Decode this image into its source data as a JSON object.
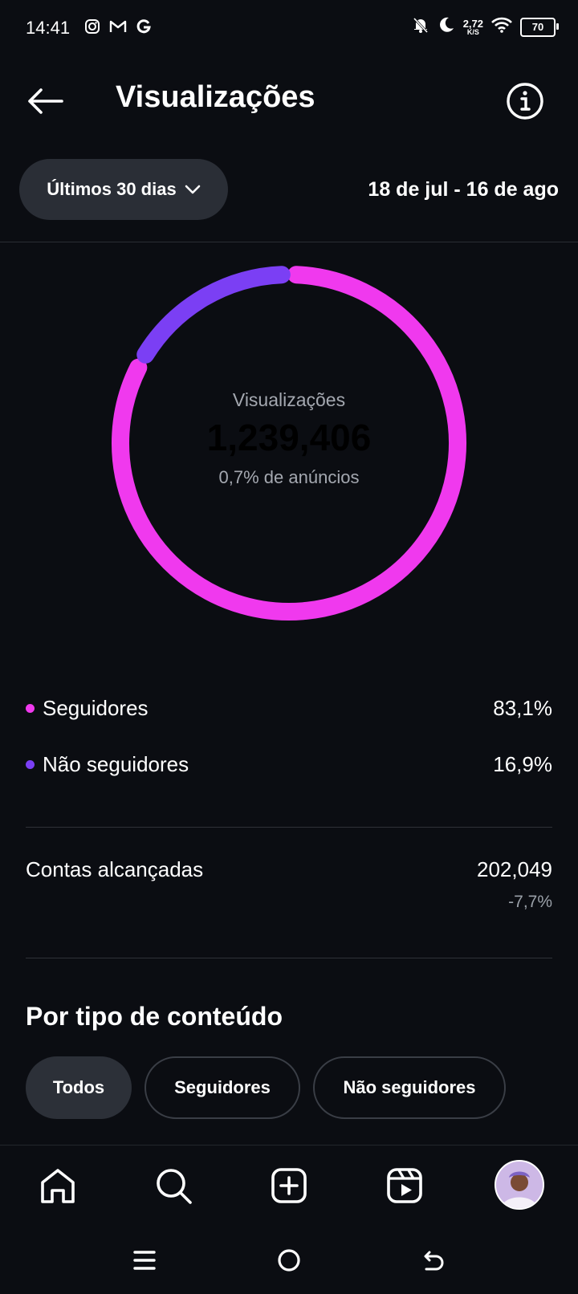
{
  "status_bar": {
    "time": "14:41",
    "net_speed": "2,72",
    "net_unit": "K/S",
    "battery": "70",
    "left_icons": [
      "instagram-icon",
      "gmail-icon",
      "google-icon"
    ],
    "right_icons": [
      "bell-muted-icon",
      "moon-icon",
      "wifi-icon",
      "battery-icon"
    ]
  },
  "header": {
    "title": "Visualizações",
    "back_icon": "arrow-left-icon",
    "info_icon": "info-icon"
  },
  "filters": {
    "range_label": "Últimos 30 dias",
    "date_range": "18 de jul - 16 de ago"
  },
  "chart_data": {
    "type": "pie",
    "style": "donut",
    "center_label": "Visualizações",
    "center_value": "1,239,406",
    "center_sub": "0,7% de anúncios",
    "series": [
      {
        "name": "Seguidores",
        "value": 83.1,
        "color": "#f039ee"
      },
      {
        "name": "Não seguidores",
        "value": 16.9,
        "color": "#7b3ff4"
      }
    ]
  },
  "legend": [
    {
      "label": "Seguidores",
      "value": "83,1%",
      "color": "#f039ee"
    },
    {
      "label": "Não seguidores",
      "value": "16,9%",
      "color": "#7b3ff4"
    }
  ],
  "reach": {
    "label": "Contas alcançadas",
    "value": "202,049",
    "change": "-7,7%"
  },
  "content_type": {
    "title": "Por tipo de conteúdo",
    "chips": [
      "Todos",
      "Seguidores",
      "Não seguidores"
    ],
    "selected": "Todos"
  },
  "bottom_nav": [
    "home-icon",
    "search-icon",
    "create-icon",
    "reels-icon",
    "profile-avatar"
  ],
  "system_nav": [
    "menu-icon",
    "home-circle-icon",
    "back-icon"
  ]
}
